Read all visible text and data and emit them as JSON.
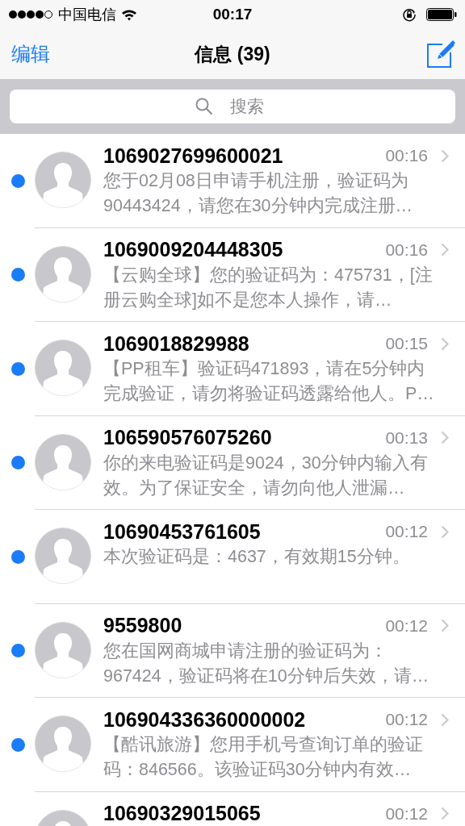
{
  "status_bar": {
    "carrier": "中国电信",
    "time": "00:17"
  },
  "nav": {
    "edit": "编辑",
    "title": "信息 (39)"
  },
  "search": {
    "placeholder": "搜索"
  },
  "messages": [
    {
      "sender": "1069027699600021",
      "time": "00:16",
      "preview": "您于02月08日申请手机注册，验证码为90443424，请您在30分钟内完成注册…",
      "unread": true
    },
    {
      "sender": "1069009204448305",
      "time": "00:16",
      "preview": "【云购全球】您的验证码为：475731，[注册云购全球]如不是您本人操作，请…",
      "unread": true
    },
    {
      "sender": "1069018829988",
      "time": "00:15",
      "preview": "【PP租车】验证码471893，请在5分钟内完成验证，请勿将验证码透露给他人。P…",
      "unread": true
    },
    {
      "sender": "106590576075260",
      "time": "00:13",
      "preview": "你的来电验证码是9024，30分钟内输入有效。为了保证安全，请勿向他人泄漏…",
      "unread": true
    },
    {
      "sender": "10690453761605",
      "time": "00:12",
      "preview": "本次验证码是：4637，有效期15分钟。",
      "unread": true
    },
    {
      "sender": "9559800",
      "time": "00:12",
      "preview": "您在国网商城申请注册的验证码为：967424，验证码将在10分钟后失效，请…",
      "unread": true
    },
    {
      "sender": "106904336360000002",
      "time": "00:12",
      "preview": "【酷讯旅游】您用手机号查询订单的验证码：846566。该验证码30分钟内有效…",
      "unread": true
    },
    {
      "sender": "10690329015065",
      "time": "00:12"
    }
  ]
}
